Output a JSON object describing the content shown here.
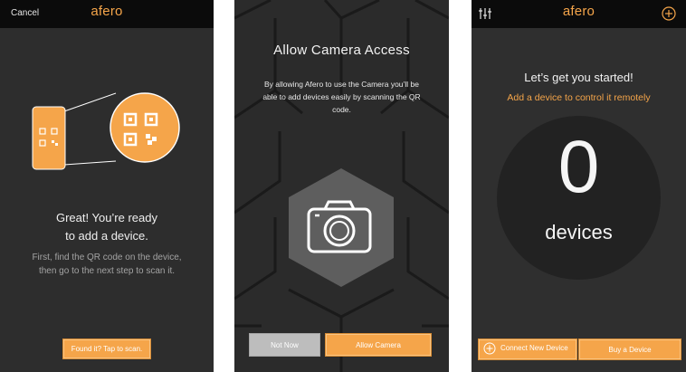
{
  "colors": {
    "accent": "#f5a54a",
    "background": "#2d2d2d",
    "topbar": "#0b0b0b",
    "gray_button": "#bdbdbd"
  },
  "screen1": {
    "cancel_label": "Cancel",
    "brand": "afero",
    "title_line1": "Great! You’re ready",
    "title_line2": "to add a device.",
    "desc_line1": "First, find the QR code on the device,",
    "desc_line2": "then go to the next step to scan it.",
    "scan_button_label": "Found it? Tap to scan.",
    "icons": [
      "phone-qr-icon",
      "qr-code-icon"
    ]
  },
  "screen2": {
    "title": "Allow Camera Access",
    "desc_line1": "By allowing Afero to use the Camera you’ll be",
    "desc_line2": "able to add devices easily by scanning the QR",
    "desc_line3": "code.",
    "not_now_label": "Not Now",
    "allow_label": "Allow Camera",
    "icons": [
      "camera-icon"
    ]
  },
  "screen3": {
    "brand": "afero",
    "title": "Let’s get you started!",
    "subtitle": "Add a device to control it remotely",
    "device_count": "0",
    "device_count_label": "devices",
    "connect_label": "Connect New Device",
    "buy_label": "Buy a Device",
    "icons": [
      "settings-sliders-icon",
      "add-circle-icon"
    ]
  }
}
